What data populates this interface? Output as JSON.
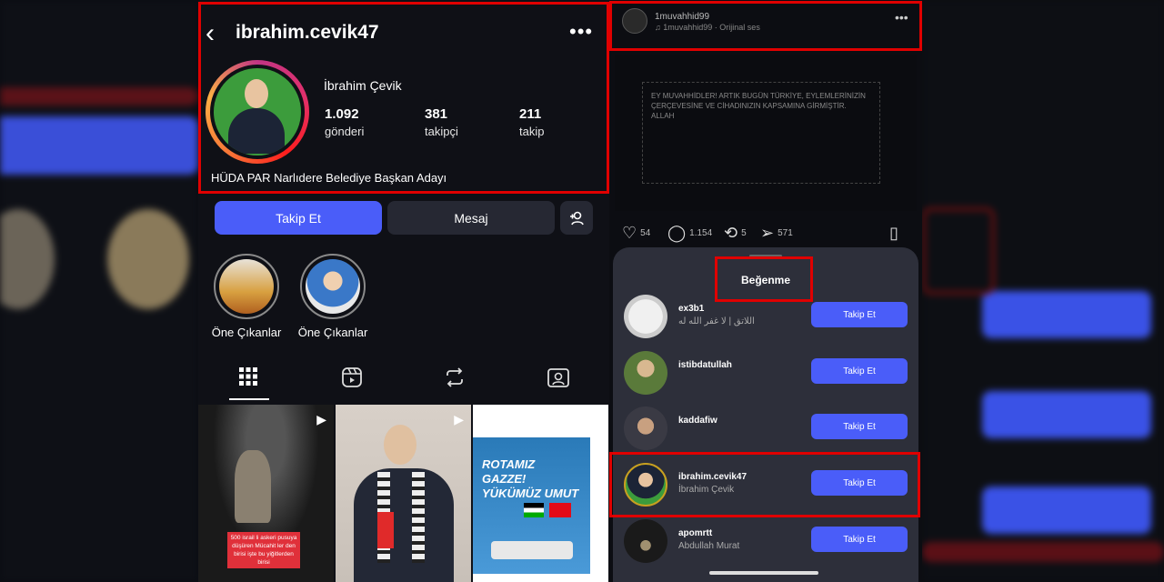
{
  "profile": {
    "username": "ibrahim.cevik47",
    "full_name": "İbrahim Çevik",
    "posts_count": "1.092",
    "posts_label": "gönderi",
    "followers_count": "381",
    "followers_label": "takipçi",
    "following_count": "211",
    "following_label": "takip",
    "bio": "HÜDA PAR Narlıdere Belediye Başkan Adayı",
    "follow_button": "Takip Et",
    "message_button": "Mesaj",
    "highlights": [
      {
        "label": "Öne Çıkanlar"
      },
      {
        "label": "Öne Çıkanlar"
      }
    ],
    "grid_posts": [
      {
        "caption": "500 israil li askeri pusuya düşüren Mücahit ler den birisi işte bu yiğitlerden birisi"
      },
      {
        "caption": ""
      },
      {
        "caption": "ROTAMIZ GAZZE! YÜKÜMÜZ UMUT"
      }
    ]
  },
  "post_view": {
    "author": "1muvahhid99",
    "audio": "1muvahhid99 · Orijinal ses",
    "post_text": "EY MUVAHHİDLER! ARTIK BUGÜN TÜRKİYE, EYLEMLERİNİZİN ÇERÇEVESİNE VE CİHADINIZIN KAPSAMINA GİRMİŞTİR. ALLAH",
    "likes": "54",
    "comments": "1.154",
    "reposts": "5",
    "shares": "571",
    "sheet_title": "Beğenme",
    "likers": [
      {
        "username": "ex3b1",
        "subtitle": "اللاتق | لا غفر الله له",
        "button": "Takip Et"
      },
      {
        "username": "istibdatullah",
        "subtitle": "",
        "button": "Takip Et"
      },
      {
        "username": "kaddafiw",
        "subtitle": "",
        "button": "Takip Et"
      },
      {
        "username": "ibrahim.cevik47",
        "subtitle": "İbrahim Çevik",
        "button": "Takip Et"
      },
      {
        "username": "apomrtt",
        "subtitle": "Abdullah Murat",
        "button": "Takip Et"
      }
    ]
  },
  "colors": {
    "accent_blue": "#4a5df9",
    "highlight_red": "#e00000",
    "background": "#0f1016",
    "sheet": "#2d2f3a"
  }
}
